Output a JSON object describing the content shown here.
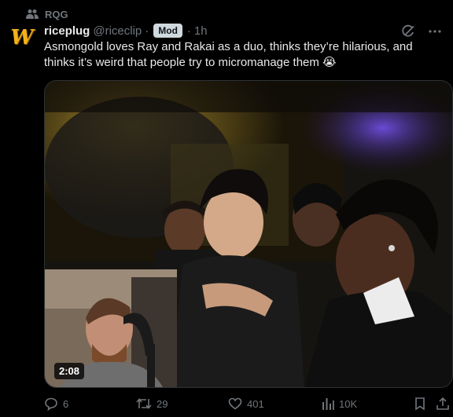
{
  "community": {
    "name": "RQG",
    "icon": "people-icon"
  },
  "post": {
    "display_name": "riceplug",
    "handle": "@riceclip",
    "separator": "·",
    "badge": "Mod",
    "time": "1h",
    "text": "Asmongold loves Ray and Rakai as a duo, thinks they’re hilarious, and thinks it’s weird that people try to micromanage them 😭",
    "avatar_letter": "W"
  },
  "media": {
    "duration": "2:08"
  },
  "actions": {
    "replies": "6",
    "reposts": "29",
    "likes": "401",
    "views": "10K"
  },
  "colors": {
    "muted": "#71767b",
    "text": "#e7e9ea",
    "background": "#000000",
    "avatar": "#f2b21b"
  }
}
